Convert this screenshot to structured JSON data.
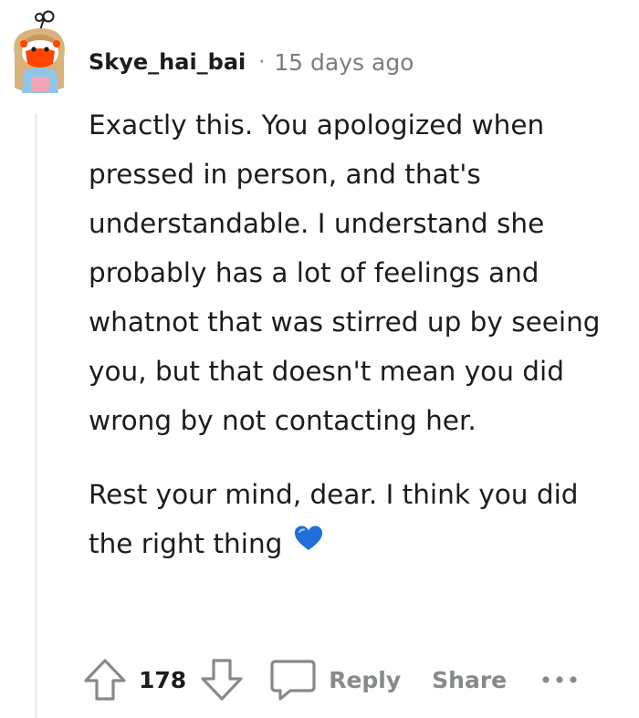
{
  "comment": {
    "author": "Skye_hai_bai",
    "separator": "·",
    "timestamp": "15 days ago",
    "paragraphs": [
      "Exactly this. You apologized when pressed in person, and that's understandable. I understand she probably has a lot of feelings and whatnot that was stirred up by seeing you, but that doesn't mean you did wrong by not contacting her.",
      "Rest your mind, dear. I think you did the right thing"
    ],
    "emoji": "blue-heart-icon"
  },
  "actions": {
    "score": "178",
    "reply_label": "Reply",
    "share_label": "Share"
  },
  "colors": {
    "text": "#1c1c1c",
    "meta": "#7c7c7c",
    "action_gray": "#878a8c",
    "heart": "#1e6fd9",
    "thread_line": "#edeff1"
  }
}
